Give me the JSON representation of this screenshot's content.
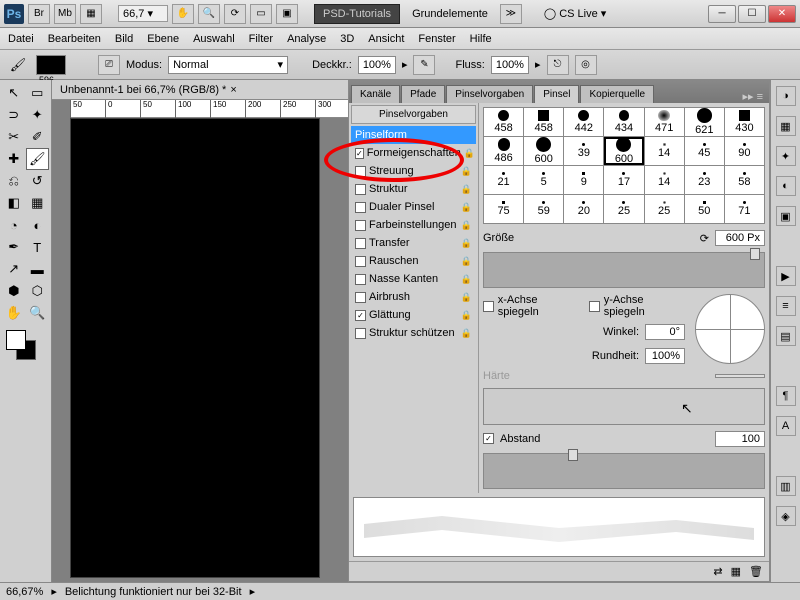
{
  "titlebar": {
    "zoom": "66,7",
    "workspace_dark": "PSD-Tutorials",
    "workspace_light": "Grundelemente",
    "cs_live": "CS Live"
  },
  "menu": [
    "Datei",
    "Bearbeiten",
    "Bild",
    "Ebene",
    "Auswahl",
    "Filter",
    "Analyse",
    "3D",
    "Ansicht",
    "Fenster",
    "Hilfe"
  ],
  "options": {
    "swatch_num": "596",
    "modus_label": "Modus:",
    "modus_value": "Normal",
    "deck_label": "Deckkr.:",
    "deck_value": "100%",
    "fluss_label": "Fluss:",
    "fluss_value": "100%"
  },
  "doc_tab": "Unbenannt-1 bei 66,7% (RGB/8) *",
  "ruler_h": [
    "50",
    "0",
    "50",
    "100",
    "150",
    "200",
    "250",
    "300"
  ],
  "panel_tabs": [
    "Kanäle",
    "Pfade",
    "Pinselvorgaben",
    "Pinsel",
    "Kopierquelle"
  ],
  "panel_active": 3,
  "brush_side": {
    "header": "Pinselvorgaben",
    "items": [
      {
        "label": "Pinselform",
        "checked": null,
        "selected": true,
        "lock": false
      },
      {
        "label": "Formeigenschaften",
        "checked": true,
        "lock": true
      },
      {
        "label": "Streuung",
        "checked": false,
        "lock": true
      },
      {
        "label": "Struktur",
        "checked": false,
        "lock": true
      },
      {
        "label": "Dualer Pinsel",
        "checked": false,
        "lock": true
      },
      {
        "label": "Farbeinstellungen",
        "checked": false,
        "lock": true
      },
      {
        "label": "Transfer",
        "checked": false,
        "lock": true
      },
      {
        "label": "Rauschen",
        "checked": false,
        "lock": true
      },
      {
        "label": "Nasse Kanten",
        "checked": false,
        "lock": true
      },
      {
        "label": "Airbrush",
        "checked": false,
        "lock": true
      },
      {
        "label": "Glättung",
        "checked": true,
        "lock": true
      },
      {
        "label": "Struktur schützen",
        "checked": false,
        "lock": true
      }
    ]
  },
  "brushes": {
    "sizes_row1": [
      "458",
      "458",
      "442",
      "434",
      "471",
      "621",
      "430"
    ],
    "sizes_row2": [
      "486",
      "600",
      "39",
      "600",
      "14",
      "45",
      "90"
    ],
    "sizes_row3": [
      "21",
      "5",
      "9",
      "17",
      "14",
      "23",
      "58"
    ],
    "sizes_row4": [
      "75",
      "59",
      "20",
      "25",
      "25",
      "50",
      "71"
    ],
    "selected_index": 10
  },
  "brush_settings": {
    "size_label": "Größe",
    "size_value": "600 Px",
    "flip_x": "x-Achse spiegeln",
    "flip_y": "y-Achse spiegeln",
    "angle_label": "Winkel:",
    "angle_value": "0°",
    "round_label": "Rundheit:",
    "round_value": "100%",
    "hard_label": "Härte",
    "spacing_label": "Abstand",
    "spacing_value": "100",
    "spacing_checked": true
  },
  "statusbar": {
    "zoom": "66,67%",
    "msg": "Belichtung funktioniert nur bei 32-Bit"
  }
}
